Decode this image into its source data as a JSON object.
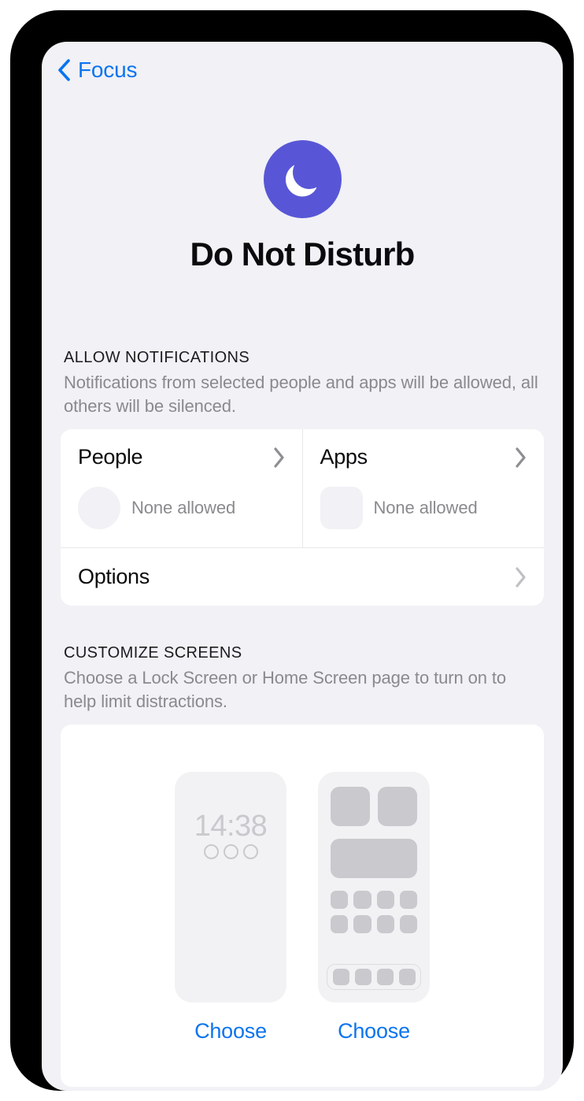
{
  "nav": {
    "back_label": "Focus",
    "back_icon": "chevron-left-icon"
  },
  "hero": {
    "icon": "crescent-moon-icon",
    "icon_color": "#5856D6",
    "title": "Do Not Disturb"
  },
  "allow_notifications": {
    "section_title": "ALLOW NOTIFICATIONS",
    "section_desc": "Notifications from selected people and apps will be allowed, all others will be silenced.",
    "people": {
      "title": "People",
      "subtitle": "None allowed",
      "chevron_icon": "chevron-right-icon",
      "placeholder": "circle-avatar-placeholder"
    },
    "apps": {
      "title": "Apps",
      "subtitle": "None allowed",
      "chevron_icon": "chevron-right-icon",
      "placeholder": "rounded-square-app-placeholder"
    },
    "options": {
      "title": "Options",
      "chevron_icon": "chevron-right-icon"
    }
  },
  "customize_screens": {
    "section_title": "CUSTOMIZE SCREENS",
    "section_desc": "Choose a Lock Screen or Home Screen page to turn on to help limit distractions.",
    "lock_screen": {
      "time": "14:38",
      "choose_label": "Choose"
    },
    "home_screen": {
      "choose_label": "Choose"
    }
  },
  "colors": {
    "accent_blue": "#0A74F0",
    "focus_purple": "#5856D6",
    "page_background": "#F1F1F6",
    "card_background": "#FFFFFF",
    "secondary_text": "#8A8A8E",
    "placeholder_gray": "#C9C9CE"
  }
}
